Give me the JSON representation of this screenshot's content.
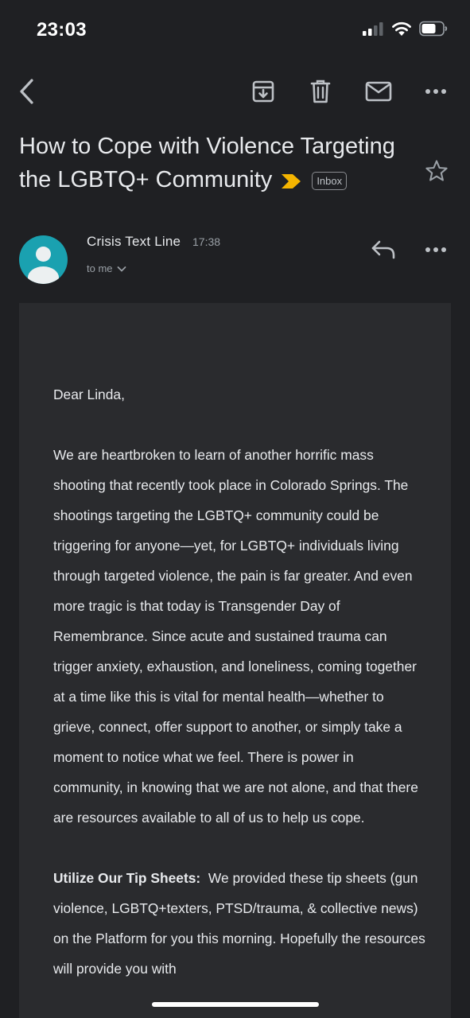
{
  "status_bar": {
    "time": "23:03",
    "icons": [
      "cellular-signal-icon",
      "wifi-icon",
      "battery-icon"
    ]
  },
  "toolbar": {
    "icons": [
      "back-icon",
      "archive-icon",
      "trash-icon",
      "mail-icon",
      "more-icon"
    ]
  },
  "email": {
    "subject": "How to Cope with Violence Targeting the LGBTQ+ Community",
    "label": "Inbox",
    "important_marker_color": "#f4b400",
    "sender": "Crisis Text Line",
    "time": "17:38",
    "recipient": "to me",
    "avatar_color": "#1aa1b0",
    "greeting": "Dear Linda,",
    "paragraph1": "We are heartbroken to learn of another horrific mass shooting that recently took place in Colorado Springs. The shootings targeting the LGBTQ+ community could be triggering for anyone—yet, for LGBTQ+ individuals living through targeted violence, the pain is far greater. And even more tragic is that today is Transgender Day of Remembrance. Since acute and sustained trauma can trigger anxiety, exhaustion, and loneliness, coming together at a time like this is vital for mental health—whether to grieve, connect, offer support to another, or simply take a moment to notice what we feel. There is power in community, in knowing that we are not alone, and that there are resources available to all of us to help us cope.",
    "tip_heading": "Utilize Our Tip Sheets:",
    "tip_text": "We provided these tip sheets (gun violence, LGBTQ+texters, PTSD/trauma, & collective news) on the Platform for you this morning. Hopefully the resources will provide you with"
  },
  "colors": {
    "background": "#1f2023",
    "body_card": "#2a2b2e",
    "text": "#e8eaed",
    "muted": "#9aa0a6"
  }
}
